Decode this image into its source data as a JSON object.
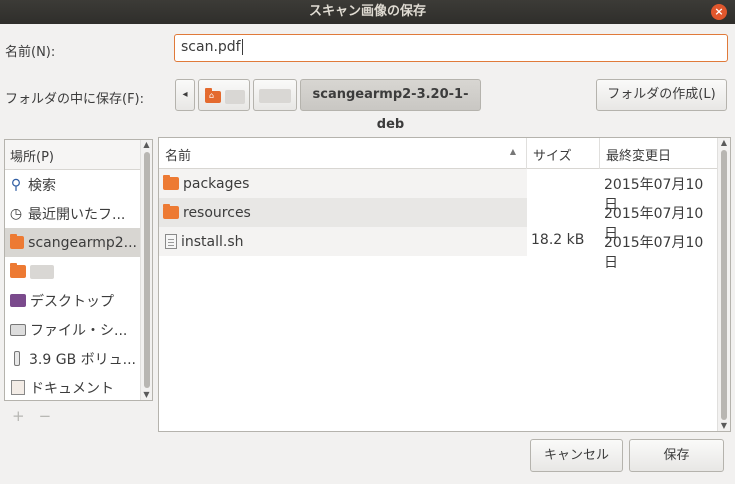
{
  "window": {
    "title": "スキャン画像の保存",
    "close_glyph": "×"
  },
  "name_label": "名前(N):",
  "name_value": "scan.pdf",
  "folder_label": "フォルダの中に保存(F):",
  "path": {
    "back_glyph": "◂",
    "current": "scangearmp2-3.20-1-deb"
  },
  "create_folder_label": "フォルダの作成(L)",
  "places": {
    "header": "場所(P)",
    "items": [
      {
        "label": "検索",
        "icon": "search-icon"
      },
      {
        "label": "最近開いたフ...",
        "icon": "recent-icon"
      },
      {
        "label": "scangearmp2...",
        "icon": "folder-icon"
      },
      {
        "label": "",
        "icon": "home-icon"
      },
      {
        "label": "デスクトップ",
        "icon": "desktop-icon"
      },
      {
        "label": "ファイル・シ...",
        "icon": "drive-icon"
      },
      {
        "label": "3.9 GB ボリュ...",
        "icon": "usb-icon"
      },
      {
        "label": "ドキュメント",
        "icon": "documents-icon"
      }
    ],
    "add_glyph": "+",
    "remove_glyph": "−"
  },
  "files": {
    "columns": {
      "name": "名前",
      "size": "サイズ",
      "modified": "最終変更日"
    },
    "sort_glyph": "▲",
    "rows": [
      {
        "name": "packages",
        "type": "folder",
        "size": "",
        "modified": "2015年07月10日"
      },
      {
        "name": "resources",
        "type": "folder",
        "size": "",
        "modified": "2015年07月10日"
      },
      {
        "name": "install.sh",
        "type": "file",
        "size": "18.2 kB",
        "modified": "2015年07月10日"
      }
    ]
  },
  "buttons": {
    "cancel": "キャンセル",
    "save": "保存"
  },
  "colors": {
    "accent": "#e46a2e",
    "titlebar": "#3c3b37",
    "close": "#e0572d"
  }
}
